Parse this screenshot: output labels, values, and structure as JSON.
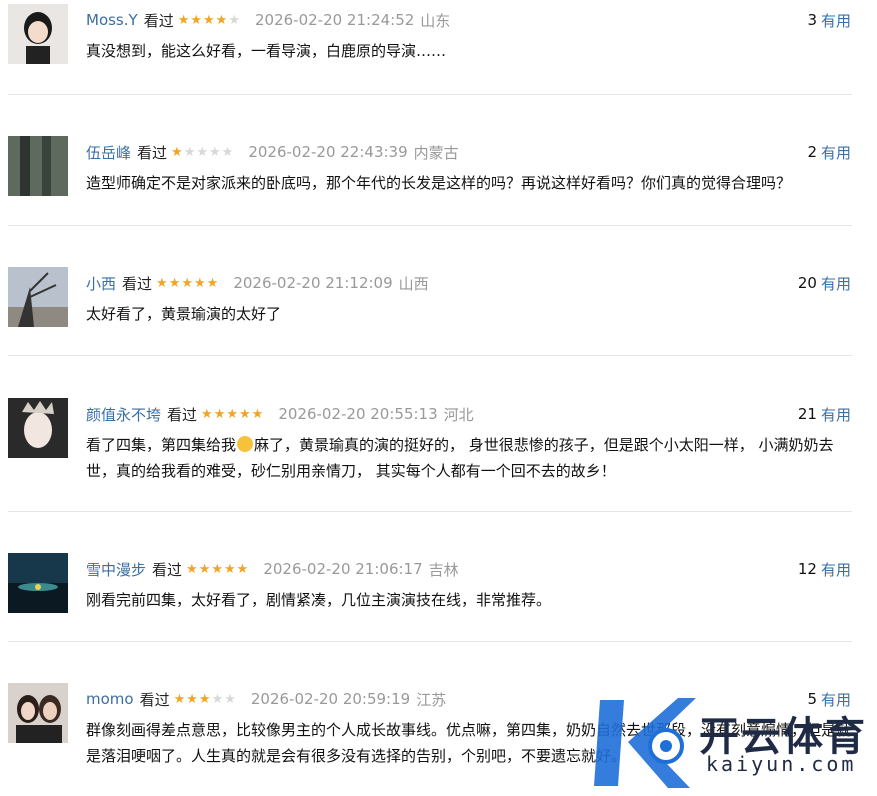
{
  "comments": [
    {
      "user": "Moss.Y",
      "watched": "看过",
      "rating": 4,
      "time": "2026-02-20 21:24:52",
      "location": "山东",
      "useful_count": "3",
      "useful_label": "有用",
      "text": "真没想到，能这么好看，一看导演，白鹿原的导演……",
      "avatar_color": "#e9e6e4"
    },
    {
      "user": "伍岳峰",
      "watched": "看过",
      "rating": 1,
      "time": "2026-02-20 22:43:39",
      "location": "内蒙古",
      "useful_count": "2",
      "useful_label": "有用",
      "text": "造型师确定不是对家派来的卧底吗，那个年代的长发是这样的吗？再说这样好看吗？你们真的觉得合理吗？",
      "avatar_color": "#6f7a6c"
    },
    {
      "user": "小西",
      "watched": "看过",
      "rating": 5,
      "time": "2026-02-20 21:12:09",
      "location": "山西",
      "useful_count": "20",
      "useful_label": "有用",
      "text": "太好看了，黄景瑜演的太好了",
      "avatar_color": "#b9c2cc"
    },
    {
      "user": "颜值永不垮",
      "watched": "看过",
      "rating": 5,
      "time": "2026-02-20 20:55:13",
      "location": "河北",
      "useful_count": "21",
      "useful_label": "有用",
      "text_a": "看了四集，第四集给我",
      "text_b": "麻了，黄景瑜真的演的挺好的， 身世很悲惨的孩子，但是跟个小太阳一样， 小满奶奶去世，真的给我看的难受，砂仁别用亲情刀， 其实每个人都有一个回不去的故乡！",
      "avatar_color": "#d8d4d2"
    },
    {
      "user": "雪中漫步",
      "watched": "看过",
      "rating": 5,
      "time": "2026-02-20 21:06:17",
      "location": "吉林",
      "useful_count": "12",
      "useful_label": "有用",
      "text": "刚看完前四集，太好看了，剧情紧凑，几位主演演技在线，非常推荐。",
      "avatar_color": "#1e4a5e"
    },
    {
      "user": "momo",
      "watched": "看过",
      "rating": 3,
      "time": "2026-02-20 20:59:19",
      "location": "江苏",
      "useful_count": "5",
      "useful_label": "有用",
      "text": "群像刻画得差点意思，比较像男主的个人成长故事线。优点嘛，第四集，奶奶自然去世那段，没有刻意煽情，但是就是落泪哽咽了。人生真的就是会有很多没有选择的告别，个别吧，不要遗忘就好。",
      "avatar_color": "#5a4a44"
    }
  ],
  "watermark": {
    "title": "开云体育",
    "domain": "kaiyun.com"
  }
}
